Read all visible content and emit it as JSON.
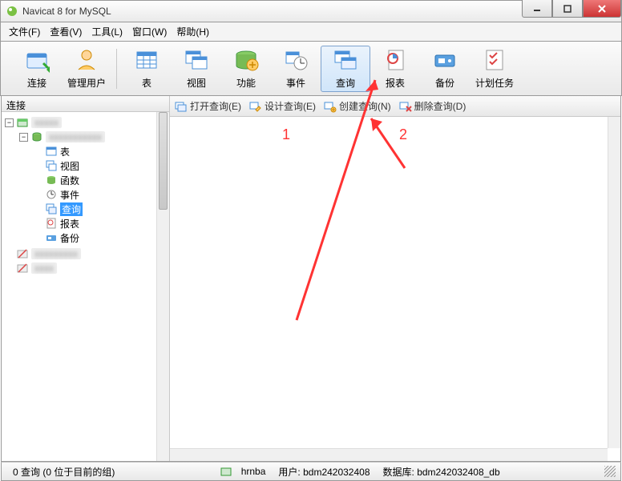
{
  "window": {
    "title": "Navicat 8 for MySQL"
  },
  "menu": {
    "file": "文件(F)",
    "view": "查看(V)",
    "tools": "工具(L)",
    "window": "窗口(W)",
    "help": "帮助(H)"
  },
  "toolbar": {
    "connect": "连接",
    "users": "管理用户",
    "table": "表",
    "view": "视图",
    "function": "功能",
    "event": "事件",
    "query": "查询",
    "report": "报表",
    "backup": "备份",
    "schedule": "计划任务"
  },
  "side": {
    "header": "连接"
  },
  "tree": {
    "node_table": "表",
    "node_view": "视图",
    "node_function": "函数",
    "node_event": "事件",
    "node_query": "查询",
    "node_report": "报表",
    "node_backup": "备份"
  },
  "subtoolbar": {
    "open": "打开查询(E)",
    "design": "设计查询(E)",
    "create": "创建查询(N)",
    "delete": "删除查询(D)"
  },
  "status": {
    "left": "0 查询 (0 位于目前的组)",
    "conn": "hrnba",
    "user_label": "用户:",
    "user_val": "bdm242032408",
    "db_label": "数据库:",
    "db_val": "bdm242032408_db"
  },
  "annotation": {
    "n1": "1",
    "n2": "2"
  }
}
